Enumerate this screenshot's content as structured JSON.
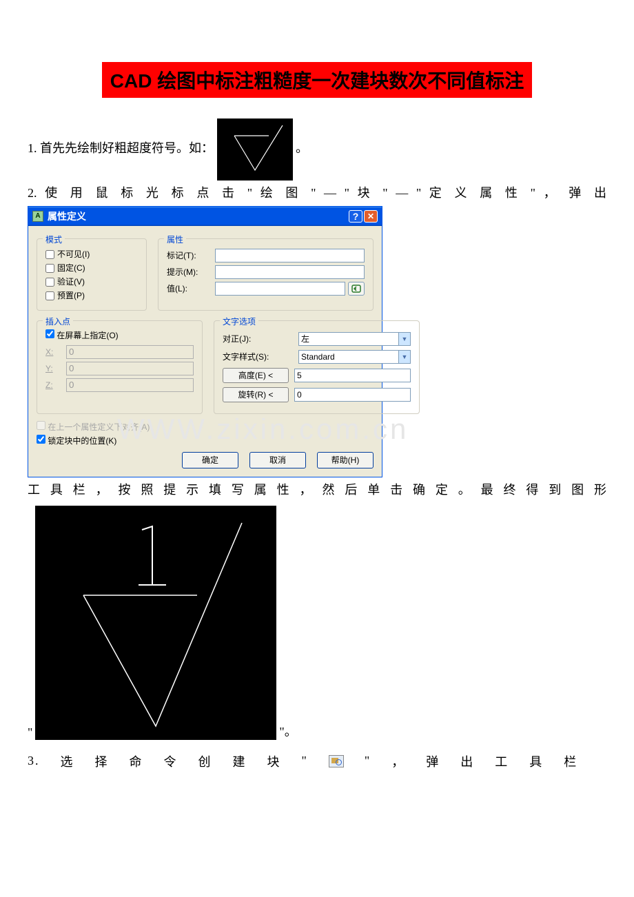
{
  "title": "CAD 绘图中标注粗糙度一次建块数次不同值标注",
  "p1_prefix": "1. 首先先绘制好粗超度符号。如：",
  "p1_suffix": "。",
  "p2": "2. 使 用 鼠 标 光 标 点 击 \" 绘 图 \" — \" 块 \" — \" 定 义 属 性 \" ， 弹 出",
  "dialog": {
    "title": "属性定义",
    "mode": {
      "legend": "模式",
      "invisible": "不可见(I)",
      "constant": "固定(C)",
      "verify": "验证(V)",
      "preset": "预置(P)"
    },
    "attr": {
      "legend": "属性",
      "tag": "标记(T):",
      "prompt": "提示(M):",
      "value": "值(L):"
    },
    "insert": {
      "legend": "插入点",
      "onscreen": "在屏幕上指定(O)",
      "x_label": "X:",
      "y_label": "Y:",
      "z_label": "Z:",
      "x_val": "0",
      "y_val": "0",
      "z_val": "0"
    },
    "textopt": {
      "legend": "文字选项",
      "justify": "对正(J):",
      "justify_val": "左",
      "style": "文字样式(S):",
      "style_val": "Standard",
      "height_btn": "高度(E) <",
      "height_val": "5",
      "rotation_btn": "旋转(R) <",
      "rotation_val": "0"
    },
    "align_prev": "在上一个属性定义下对齐(A)",
    "lock_pos": "锁定块中的位置(K)",
    "ok": "确定",
    "cancel": "取消",
    "help": "帮助(H)"
  },
  "watermark": "WWW.zixin.com.cn",
  "p_after_dialog": "工 具 栏 ， 按 照 提 示 填 写 属 性 ， 然 后 单 击 确 定 。 最 终 得 到 图 形",
  "quote_open": "\"",
  "quote_close": "\"。",
  "p3_a": "3.",
  "p3_b": "选",
  "p3_c": "择",
  "p3_d": "命",
  "p3_e": "令",
  "p3_f": "创",
  "p3_g": "建",
  "p3_h": "块",
  "p3_q1": "\"",
  "p3_q2": "\"",
  "p3_comma": "，",
  "p3_i": "弹",
  "p3_j": "出",
  "p3_k": "工",
  "p3_l": "具",
  "p3_m": "栏"
}
